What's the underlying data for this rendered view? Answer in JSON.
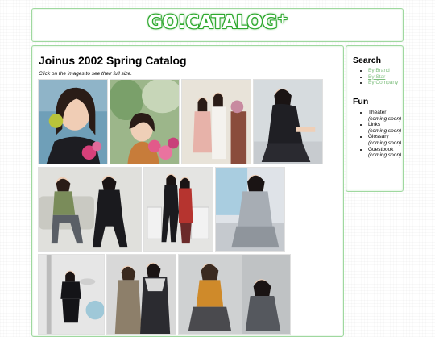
{
  "header": {
    "logo_text": "GO!CATALOG",
    "logo_plus": "+"
  },
  "main": {
    "title": "Joinus 2002 Spring Catalog",
    "instructions": "Click on the images to see their full size.",
    "photos": [
      "catalog-photo-1",
      "catalog-photo-2",
      "catalog-photo-3",
      "catalog-photo-4",
      "catalog-photo-5",
      "catalog-photo-6",
      "catalog-photo-7",
      "catalog-photo-8",
      "catalog-photo-9",
      "catalog-photo-10"
    ]
  },
  "sidebar": {
    "search_heading": "Search",
    "search_links": [
      "By Brand",
      "By Star",
      "By Company"
    ],
    "fun_heading": "Fun",
    "fun_items": [
      {
        "label": "Theater",
        "note": "(coming soon)"
      },
      {
        "label": "Links",
        "note": "(coming soon)"
      },
      {
        "label": "Glossary",
        "note": "(coming soon)"
      },
      {
        "label": "Guestbook",
        "note": "(coming soon)"
      }
    ]
  },
  "colors": {
    "accent_green": "#2fa82f",
    "border_green": "#9fd89f",
    "link_green": "#7fbf7f"
  }
}
